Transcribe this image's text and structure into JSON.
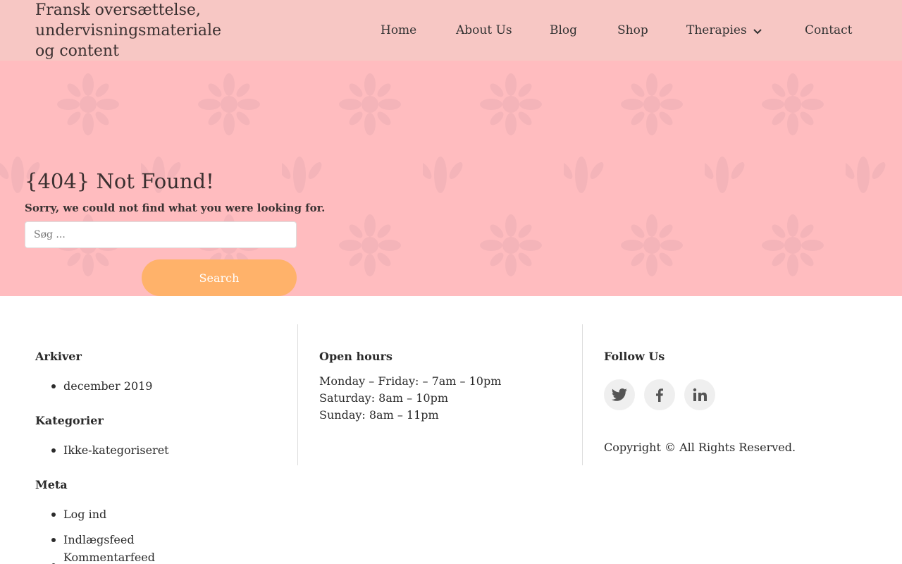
{
  "header": {
    "site_title": "Fransk oversættelse, undervisningsmateriale og content",
    "nav": [
      "Home",
      "About Us",
      "Blog",
      "Shop",
      "Therapies",
      "Contact"
    ],
    "background_color": "#f7c7c4"
  },
  "hero": {
    "title": "{404} Not Found!",
    "message": "Sorry, we could not find what you were looking for.",
    "search_placeholder": "Søg ...",
    "search_button": "Search",
    "background_color": "#ffbcbf",
    "button_color": "#ffb26a"
  },
  "footer": {
    "archives": {
      "title": "Arkiver",
      "items": [
        "december 2019"
      ]
    },
    "categories": {
      "title": "Kategorier",
      "items": [
        "Ikke-kategoriseret"
      ]
    },
    "meta": {
      "title": "Meta",
      "items": [
        "Log ind",
        "Indlægsfeed",
        "Kommentarfeed"
      ]
    },
    "open_hours": {
      "title": "Open hours",
      "lines": [
        "Monday – Friday: – 7am – 10pm",
        "Saturday: 8am – 10pm",
        "Sunday: 8am – 11pm"
      ]
    },
    "follow_us": {
      "title": "Follow Us",
      "icons": [
        "twitter-icon",
        "facebook-icon",
        "linkedin-icon"
      ]
    },
    "copyright": "Copyright © All Rights Reserved."
  }
}
